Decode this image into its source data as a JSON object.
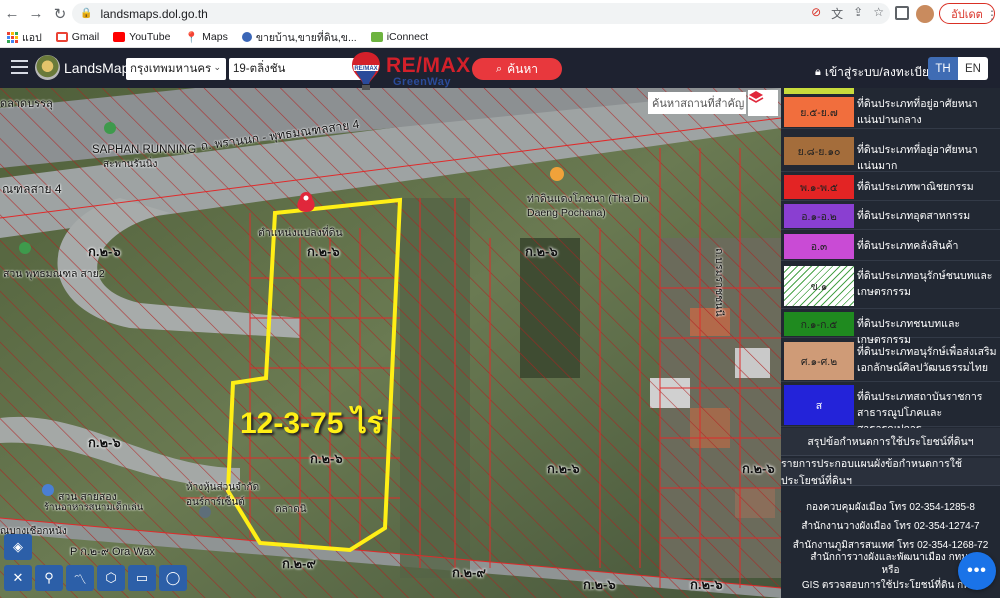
{
  "browser": {
    "url": "landsmaps.dol.go.th",
    "update_label": "อัปเดต",
    "bookmarks": [
      {
        "label": "แอป",
        "color": "#1a73e8"
      },
      {
        "label": "Gmail",
        "color": "#ea4335"
      },
      {
        "label": "YouTube",
        "color": "#ff0000"
      },
      {
        "label": "Maps",
        "color": "#34a853"
      },
      {
        "label": "ขายบ้าน,ขายที่ดิน,ข...",
        "color": "#3a66b7"
      },
      {
        "label": "iConnect",
        "color": "#6db33f"
      }
    ]
  },
  "app": {
    "brand": "LandsMaps",
    "province": "กรุงเทพมหานคร",
    "district": "19-ตลิ่งชัน",
    "search_label": "ค้นหา",
    "login_label": "เข้าสู่ระบบ/ลงทะเบียน",
    "lang_th": "TH",
    "lang_en": "EN"
  },
  "overlay": {
    "remax_text": "RE/MAX",
    "remax_balloon_text": "RE/MAX",
    "remax_sub": "GreenWay"
  },
  "map": {
    "place_search_placeholder": "ค้นหาสถานที่สำคัญ",
    "area_label": "12-3-75 ไร่",
    "pin_label": "ตำแหน่งแปลงที่ดิน",
    "road_label": "ถ. พรานนก - พุทธมณฑลสาย 4",
    "road_label_2": "ณฑลสาย 4",
    "road_label_3": "ถ.บรมราชชนนี",
    "poi_saphan": "SAPHAN RUNNING",
    "poi_saphan_th": "สะพานรันนิ่ง",
    "poi_tha_din": "ท่าดินแดงโภชนา (Tha Din Daeng Pochana)",
    "poi_park": "สวน พุทธมณฑล สาย2",
    "poi_park2": "สวน สายสอง",
    "poi_park2_sub": "ร้านอาหารสนามเด็กเล่น",
    "poi_shop": "ห้างหุ้นส่วนจำกัด อนร์การ์เซ็นต์",
    "poi_market": "ตลาดนิ",
    "poi_top_left": "ดลาดบรรลุ",
    "poi_bottom_left": "ณบางเชือกหนัง",
    "poi_carwax": "P ก.๒-๙ Ora Wax",
    "parcel_labels": [
      "ก.๒-๖",
      "ก.๒-๖",
      "ก.๒-๖",
      "ก.๒-๖",
      "ก.๒-๖",
      "ก.๒-๖",
      "ก.๒-๖",
      "ก.๒-๙",
      "ก.๒-๙",
      "ก.๒-๖",
      "ก.๒-๖"
    ]
  },
  "legend": {
    "items": [
      {
        "code": "",
        "text": "",
        "color": "#c9dc3c"
      },
      {
        "code": "ย.๕-ย.๗",
        "text": "ที่ดินประเภทที่อยู่อาศัยหนาแน่นปานกลาง",
        "color": "#f16e3d"
      },
      {
        "code": "ย.๘-ย.๑๐",
        "text": "ที่ดินประเภทที่อยู่อาศัยหนาแน่นมาก",
        "color": "#a46d3b"
      },
      {
        "code": "พ.๑-พ.๕",
        "text": "ที่ดินประเภทพาณิชยกรรม",
        "color": "#e32424"
      },
      {
        "code": "อ.๑-อ.๒",
        "text": "ที่ดินประเภทอุตสาหกรรม",
        "color": "#8a3fd1"
      },
      {
        "code": "อ.๓",
        "text": "ที่ดินประเภทคลังสินค้า",
        "color": "#c94bd5"
      },
      {
        "code": "ข.๑",
        "text": "ที่ดินประเภทอนุรักษ์ชนบทและเกษตรกรรม",
        "color": "#ffffff"
      },
      {
        "code": "ก.๑-ก.๕",
        "text": "ที่ดินประเภทชนบทและเกษตรกรรม",
        "color": "#1f8a1f"
      },
      {
        "code": "ศ.๑-ศ.๒",
        "text": "ที่ดินประเภทอนุรักษ์เพื่อส่งเสริมเอกลักษณ์ศิลปวัฒนธรรมไทย",
        "color": "#cf9b77"
      },
      {
        "code": "ส",
        "text": "ที่ดินประเภทสถาบันราชการ สาธารณูปโภคและสาธารณูปการ",
        "color": "#2323d9"
      }
    ],
    "summary_1": "สรุปข้อกำหนดการใช้ประโยชน์ที่ดินฯ",
    "summary_2": "รายการประกอบแผนผังข้อกำหนดการใช้ประโยชน์ที่ดินฯ",
    "contacts": [
      "กองควบคุมผังเมือง โทร 02-354-1285-8",
      "สำนักงานวางผังเมือง โทร 02-354-1274-7",
      "สำนักงานภูมิสารสนเทศ โทร 02-354-1268-72",
      "สำนักการวางผังและพัฒนาเมือง กทม.",
      "หรือ",
      "GIS ตรวจสอบการใช้ประโยชน์ที่ดิน กทม."
    ]
  },
  "chat_label": "•••"
}
